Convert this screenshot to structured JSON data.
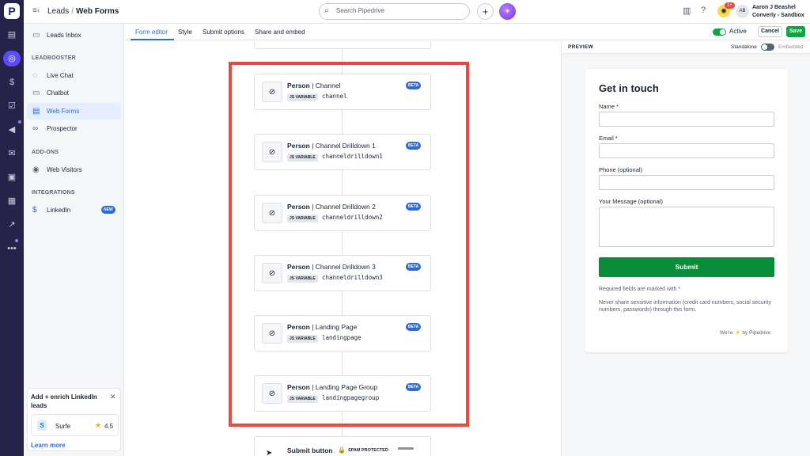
{
  "app": {
    "logo": "P"
  },
  "rail": {
    "icons": [
      "pipedrive-logo",
      "leads-icon",
      "deals-icon",
      "activities-icon",
      "campaigns-icon",
      "mail-icon",
      "calendar-icon",
      "contacts-icon",
      "insights-icon",
      "more-icon"
    ]
  },
  "topbar": {
    "breadcrumb_parent": "Leads",
    "breadcrumb_separator": "/",
    "breadcrumb_current": "Web Forms",
    "search_placeholder": "Search Pipedrive",
    "notification_count": "1+",
    "avatar_initials": "AB",
    "user_name": "Aaron J Beashel",
    "user_company": "Converly - Sandbox"
  },
  "sidebar": {
    "top_item": "Leads Inbox",
    "section_leadbooster": "LEADBOOSTER",
    "leadbooster_items": [
      "Live Chat",
      "Chatbot",
      "Web Forms",
      "Prospector"
    ],
    "section_addons": "ADD-ONS",
    "addon_items": [
      "Web Visitors"
    ],
    "section_integrations": "INTEGRATIONS",
    "integration_items": [
      "LinkedIn"
    ],
    "new_badge": "NEW",
    "promo": {
      "title": "Add + enrich LinkedIn leads",
      "app_name": "Surfe",
      "app_logo": "S",
      "rating": "4.5",
      "learn_more": "Learn more"
    }
  },
  "tabs": {
    "items": [
      "Form editor",
      "Style",
      "Submit options",
      "Share and embed"
    ],
    "active_label": "Active",
    "cancel": "Cancel",
    "save": "Save"
  },
  "editor": {
    "beta_label": "BETA",
    "js_variable_label": "JS VARIABLE",
    "fields": [
      {
        "entity": "Person",
        "name": "Channel",
        "variable": "channel"
      },
      {
        "entity": "Person",
        "name": "Channel Drilldown 1",
        "variable": "channeldrilldown1"
      },
      {
        "entity": "Person",
        "name": "Channel Drilldown 2",
        "variable": "channeldrilldown2"
      },
      {
        "entity": "Person",
        "name": "Channel Drilldown 3",
        "variable": "channeldrilldown3"
      },
      {
        "entity": "Person",
        "name": "Landing Page",
        "variable": "landingpage"
      },
      {
        "entity": "Person",
        "name": "Landing Page Group",
        "variable": "landingpagegroup"
      }
    ],
    "submit_button_label": "Submit button",
    "spam_label": "SPAM PROTECTED",
    "highlight_color": "#e9493f"
  },
  "preview": {
    "header": "PREVIEW",
    "standalone": "Standalone",
    "embedded": "Embedded",
    "form_title": "Get in touch",
    "fields": [
      "Name *",
      "Email *",
      "Phone (optional)",
      "Your Message (optional)"
    ],
    "submit": "Submit",
    "required_note": "Required fields are marked with *",
    "privacy_note": "Never share sensitive information (credit card numbers, social security numbers, passwords) through this form.",
    "powered_by_prefix": "We're",
    "powered_by_suffix": "by Pipedrive"
  },
  "colors": {
    "accent": "#2c6bd8",
    "brand_dark": "#26234a",
    "success": "#08a742"
  }
}
